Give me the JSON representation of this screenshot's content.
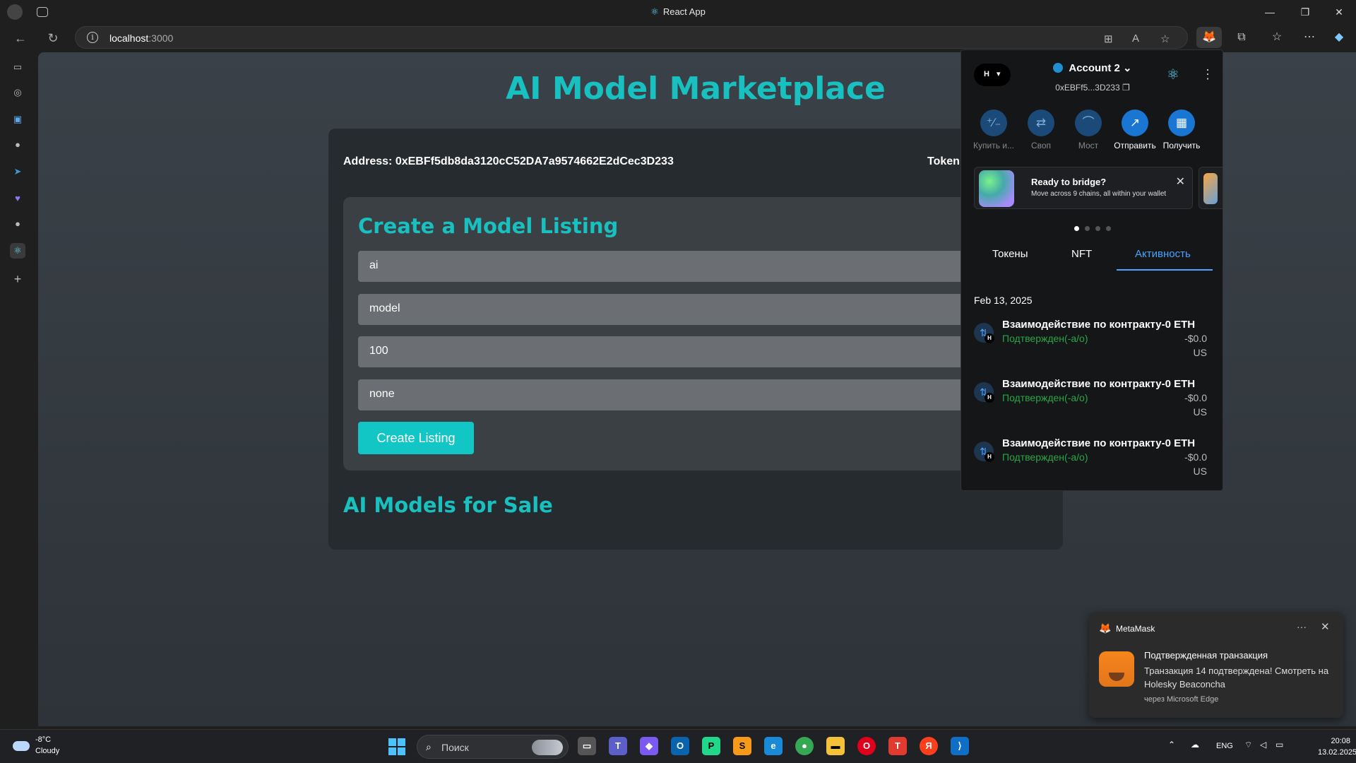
{
  "window": {
    "tab_title": "React App",
    "min": "—",
    "max": "❐",
    "close": "✕"
  },
  "addressbar": {
    "url_host": "localhost",
    "url_port": ":3000"
  },
  "page": {
    "title": "AI Model Marketplace",
    "address_label": "Address:",
    "address_value": "0xEBFf5db8da3120cC52DA7a9574662E2dCec3D233",
    "token_label": "Token",
    "form_title": "Create a Model Listing",
    "inputs": [
      "ai",
      "model",
      "100",
      "none"
    ],
    "create_button": "Create Listing",
    "sale_title": "AI Models for Sale"
  },
  "metamask": {
    "network_short": "H",
    "account_name": "Account 2",
    "account_address": "0xEBFf5...3D233",
    "actions": [
      {
        "label": "Купить и...",
        "icon": "buy-sell-icon"
      },
      {
        "label": "Своп",
        "icon": "swap-icon"
      },
      {
        "label": "Мост",
        "icon": "bridge-icon"
      },
      {
        "label": "Отправить",
        "icon": "send-icon"
      },
      {
        "label": "Получить",
        "icon": "receive-icon"
      }
    ],
    "banner_title": "Ready to bridge?",
    "banner_text": "Move across 9 chains, all within your wallet",
    "tabs": [
      "Токены",
      "NFT",
      "Активность"
    ],
    "active_tab": "Активность",
    "activity_date": "Feb 13, 2025",
    "transactions": [
      {
        "title": "Взаимодействие по контракту-0 ETH",
        "status": "Подтвержден(-а/о)",
        "amount": "-$0.0",
        "currency": "US"
      },
      {
        "title": "Взаимодействие по контракту-0 ETH",
        "status": "Подтвержден(-а/о)",
        "amount": "-$0.0",
        "currency": "US"
      },
      {
        "title": "Взаимодействие по контракту-0 ETH",
        "status": "Подтвержден(-а/о)",
        "amount": "-$0.0",
        "currency": "US"
      }
    ],
    "accent_color": "#4aa3ff",
    "status_color": "#28a745"
  },
  "notification": {
    "app": "MetaMask",
    "title": "Подтвержденная транзакция",
    "body": "Транзакция 14 подтверждена! Смотреть на Holesky Beaconcha",
    "via": "через Microsoft Edge"
  },
  "taskbar": {
    "weather_temp": "-8°C",
    "weather_cond": "Cloudy",
    "search_placeholder": "Поиск",
    "lang": "ENG",
    "time": "20:08",
    "date": "13.02.2025"
  }
}
